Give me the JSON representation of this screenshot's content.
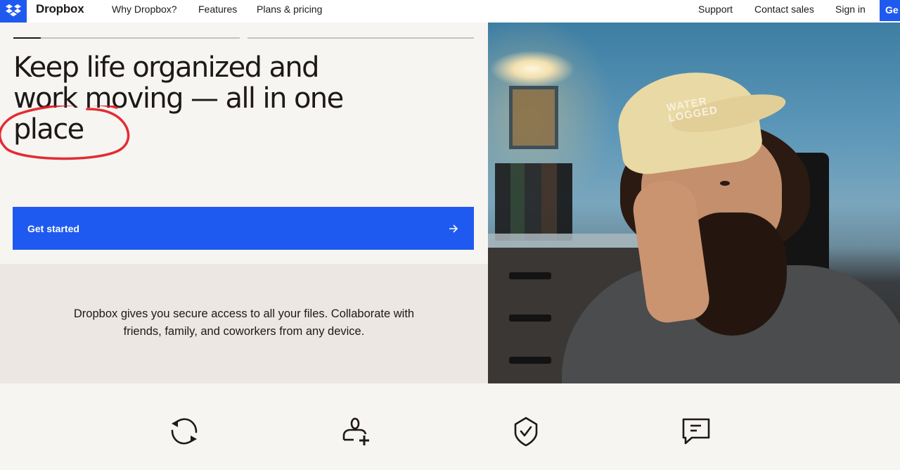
{
  "nav": {
    "brand": "Dropbox",
    "logo_icon": "dropbox-logo-icon",
    "links_left": [
      "Why Dropbox?",
      "Features",
      "Plans & pricing"
    ],
    "links_right": [
      "Support",
      "Contact sales",
      "Sign in"
    ],
    "cta_partial": "Ge"
  },
  "hero": {
    "carousel_progress": [
      0.12,
      0
    ],
    "headline_lines": [
      "Keep life organized and",
      "work moving — all in one",
      "place"
    ],
    "annotation": "red hand-drawn circle around \"place\"",
    "cta_label": "Get started",
    "cta_icon": "arrow-right-icon",
    "description_lines": [
      "Dropbox gives you secure access to all your files. Collaborate with",
      "friends, family, and coworkers from any device."
    ],
    "photo": {
      "alt": "Bearded man in a cream corduroy cap resting his head on his hand",
      "cap_text": [
        "WATER",
        "LOGGED"
      ]
    }
  },
  "features": {
    "icons": [
      "sync-icon",
      "add-user-icon",
      "shield-check-icon",
      "comment-icon"
    ]
  },
  "colors": {
    "brand_blue": "#1f5af0",
    "page_bg": "#f7f5f2",
    "panel_bg": "#ece7e2",
    "text": "#1e1919",
    "annotation_red": "#e0161e"
  }
}
